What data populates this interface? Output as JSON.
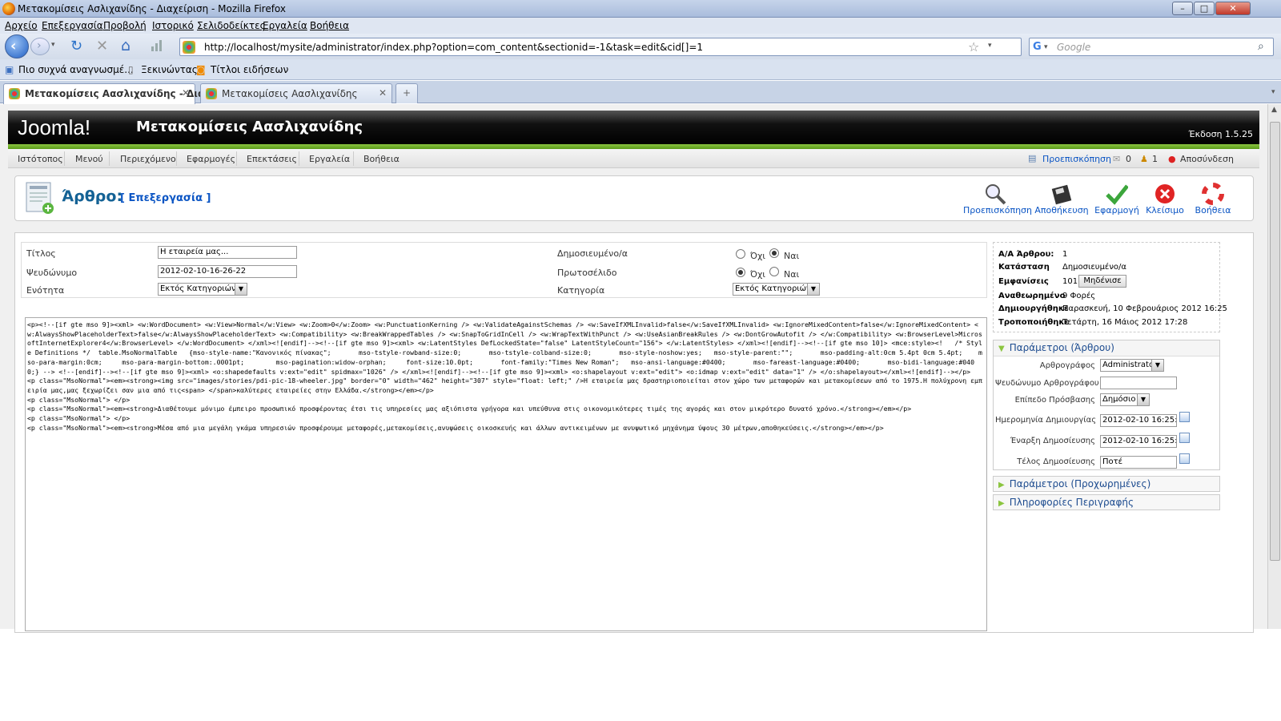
{
  "window": {
    "title": "Μετακομίσεις Ασλιχανίδης - Διαχείριση - Mozilla Firefox",
    "controls": [
      "–",
      "□",
      "✕"
    ]
  },
  "menu": [
    "Αρχείο",
    "Επεξεργασία",
    "Προβολή",
    "Ιστορικό",
    "Σελιδοδείκτες",
    "Εργαλεία",
    "Βοήθεια"
  ],
  "nav": {
    "url": "http://localhost/mysite/administrator/index.php?option=com_content&sectionid=-1&task=edit&cid[]=1",
    "search_placeholder": "Google"
  },
  "bookmarks": [
    "Πιο συχνά αναγνωσμέ...",
    "Ξεκινώντας",
    "Τίτλοι ειδήσεων"
  ],
  "tabs": [
    {
      "label": "Μετακομίσεις Αασλιχανίδης - Δια...",
      "close": "✕"
    },
    {
      "label": "Μετακομίσεις Αασλιχανίδης",
      "close": "✕"
    }
  ],
  "new_tab": "+",
  "joomla": {
    "logo": "Joomla!",
    "site_name": "Μετακομίσεις Αασλιχανίδης",
    "version": "Έκδοση 1.5.25",
    "menu": [
      "Ιστότοπος",
      "Μενού",
      "Περιεχόμενο",
      "Εφαρμογές",
      "Επεκτάσεις",
      "Εργαλεία",
      "Βοήθεια"
    ],
    "status": {
      "preview": "Προεπισκόπηση",
      "messages": "0",
      "users": "1",
      "logout": "Αποσύνδεση"
    }
  },
  "page": {
    "title": "Άρθρο:",
    "subtitle": "[ Επεξεργασία ]"
  },
  "toolbar": {
    "preview": "Προεπισκόπηση",
    "save": "Αποθήκευση",
    "apply": "Εφαρμογή",
    "close": "Κλείσιμο",
    "help": "Βοήθεια"
  },
  "form": {
    "title_label": "Τίτλος",
    "title_value": "Η εταιρεία μας...",
    "alias_label": "Ψευδώνυμο",
    "alias_value": "2012-02-10-16-26-22",
    "section_label": "Ενότητα",
    "section_value": "Εκτός Κατηγοριών",
    "published_label": "Δημοσιευμένο/α",
    "frontpage_label": "Πρωτοσέλιδο",
    "category_label": "Κατηγορία",
    "category_value": "Εκτός Κατηγοριών",
    "no": "Όχι",
    "yes": "Ναι",
    "published": "yes",
    "frontpage": "no"
  },
  "editor": {
    "content": "<p><!--[if gte mso 9]><xml> <w:WordDocument> <w:View>Normal</w:View> <w:Zoom>0</w:Zoom> <w:PunctuationKerning /> <w:ValidateAgainstSchemas /> <w:SaveIfXMLInvalid>false</w:SaveIfXMLInvalid> <w:IgnoreMixedContent>false</w:IgnoreMixedContent> <w:AlwaysShowPlaceholderText>false</w:AlwaysShowPlaceholderText> <w:Compatibility> <w:BreakWrappedTables /> <w:SnapToGridInCell /> <w:WrapTextWithPunct /> <w:UseAsianBreakRules /> <w:DontGrowAutofit /> </w:Compatibility> <w:BrowserLevel>MicrosoftInternetExplorer4</w:BrowserLevel> </w:WordDocument> </xml><![endif]--><!--[if gte mso 9]><xml> <w:LatentStyles DefLockedState=\"false\" LatentStyleCount=\"156\"> </w:LatentStyles> </xml><![endif]--><!--[if gte mso 10]> <mce:style><!   /* Style Definitions */  table.MsoNormalTable   {mso-style-name:\"Κανονικός πίνακας\";       mso-tstyle-rowband-size:0;       mso-tstyle-colband-size:0;       mso-style-noshow:yes;   mso-style-parent:\"\";       mso-padding-alt:0cm 5.4pt 0cm 5.4pt;    mso-para-margin:0cm;     mso-para-margin-bottom:.0001pt;        mso-pagination:widow-orphan;     font-size:10.0pt;       font-family:\"Times New Roman\";   mso-ansi-language:#0400;       mso-fareast-language:#0400;       mso-bidi-language:#0400;} --> <!--[endif]--><!--[if gte mso 9]><xml> <o:shapedefaults v:ext=\"edit\" spidmax=\"1026\" /> </xml><![endif]--><!--[if gte mso 9]><xml> <o:shapelayout v:ext=\"edit\"> <o:idmap v:ext=\"edit\" data=\"1\" /> </o:shapelayout></xml><![endif]--></p>\n<p class=\"MsoNormal\"><em><strong><img src=\"images/stories/pdi-pic-18-wheeler.jpg\" border=\"0\" width=\"462\" height=\"307\" style=\"float: left;\" />Η εταιρεία μας δραστηριοποιείται στον χώρο των μεταφορών και μετακομίσεων από το 1975.Η πολύχρονη εμπειρία μας,μας ξεχωρίζει σαν μια από τις<span> </span>καλύτερες εταιρείες στην Ελλάδα.</strong></em></p>\n<p class=\"MsoNormal\"> </p>\n<p class=\"MsoNormal\"><em><strong>Διαθέτουμε μόνιμο έμπειρο προσωπικό προσφέροντας έτσι τις υπηρεσίες μας αξιόπιστα γρήγορα και υπεύθυνα στις οικονομικότερες τιμές της αγοράς και στον μικρότερο δυνατό χρόνο.</strong></em></p>\n<p class=\"MsoNormal\"> </p>\n<p class=\"MsoNormal\"><em><strong>Μέσα από μια μεγάλη γκάμα υπηρεσιών προσφέρουμε μεταφορές,μετακομίσεις,ανυψώσεις οικοσκευής και άλλων αντικειμένων με ανυψωτικό μηχάνημα ύψους 30 μέτρων,αποθηκεύσεις.</strong></em></p>"
  },
  "info": {
    "id_label": "Α/Α Άρθρου:",
    "id_value": "1",
    "state_label": "Κατάσταση",
    "state_value": "Δημοσιευμένο/α",
    "hits_label": "Εμφανίσεις",
    "hits_value": "101",
    "reset": "Μηδένισε",
    "revised_label": "Αναθεωρημένο",
    "revised_value": "9 Φορές",
    "created_label": "Δημιουργήθηκε",
    "created_value": "Παρασκευή, 10 Φεβρουάριος 2012 16:25",
    "modified_label": "Τροποποιήθηκε",
    "modified_value": "Τετάρτη, 16 Μάιος 2012 17:28"
  },
  "params": {
    "header": "Παράμετροι (Άρθρου)",
    "author_label": "Αρθρογράφος",
    "author_value": "Administrator",
    "alias_label": "Ψευδώνυμο Αρθρογράφου",
    "alias_value": "",
    "access_label": "Επίπεδο Πρόσβασης",
    "access_value": "Δημόσιο",
    "created_label": "Ημερομηνία Δημιουργίας",
    "created_value": "2012-02-10 16:25:46",
    "publish_up_label": "Έναρξη Δημοσίευσης",
    "publish_up_value": "2012-02-10 16:25:46",
    "publish_down_label": "Τέλος Δημοσίευσης",
    "publish_down_value": "Ποτέ"
  },
  "panes": {
    "advanced": "Παράμετροι (Προχωρημένες)",
    "metadata": "Πληροφορίες Περιγραφής"
  },
  "colors": {
    "accent_green": "#8bc53f",
    "link_blue": "#0b55c4",
    "header_black": "#000000"
  }
}
